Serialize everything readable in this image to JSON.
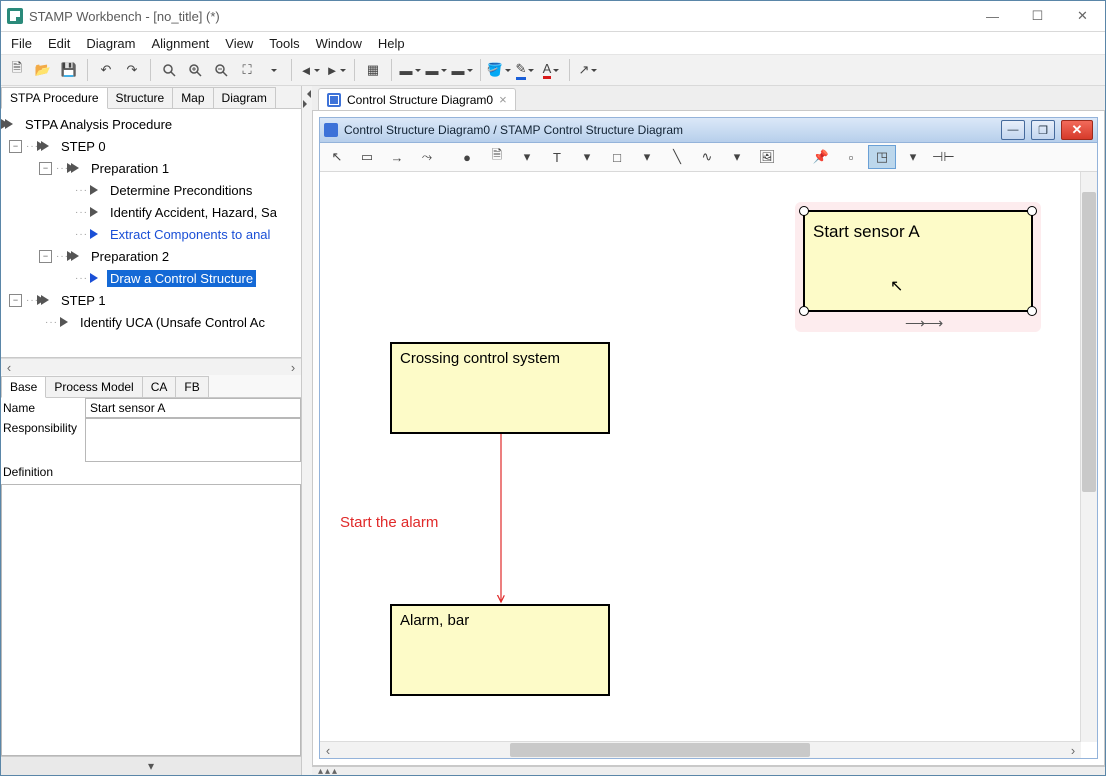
{
  "title": "STAMP Workbench - [no_title] (*)",
  "menu": [
    "File",
    "Edit",
    "Diagram",
    "Alignment",
    "View",
    "Tools",
    "Window",
    "Help"
  ],
  "left_tabs": [
    "STPA Procedure",
    "Structure",
    "Map",
    "Diagram"
  ],
  "tree": {
    "root": "STPA Analysis Procedure",
    "step0": "STEP 0",
    "prep1": "Preparation 1",
    "prep1_items": [
      "Determine Preconditions",
      "Identify Accident, Hazard, Sa",
      "Extract Components to anal"
    ],
    "prep2": "Preparation 2",
    "prep2_items": [
      "Draw a Control Structure"
    ],
    "step1": "STEP 1",
    "step1_items": [
      "Identify UCA (Unsafe Control Ac"
    ]
  },
  "prop_tabs": [
    "Base",
    "Process Model",
    "CA",
    "FB"
  ],
  "props": {
    "name_label": "Name",
    "name_value": "Start sensor A",
    "resp_label": "Responsibility",
    "def_label": "Definition"
  },
  "right_tab": "Control Structure Diagram0",
  "subwindow_title": "Control Structure Diagram0 / STAMP Control Structure Diagram",
  "diagram": {
    "box1": "Crossing control system",
    "box2": "Alarm, bar",
    "box3": "Start sensor A",
    "link_label": "Start the alarm"
  },
  "collapse_glyph": "▾"
}
